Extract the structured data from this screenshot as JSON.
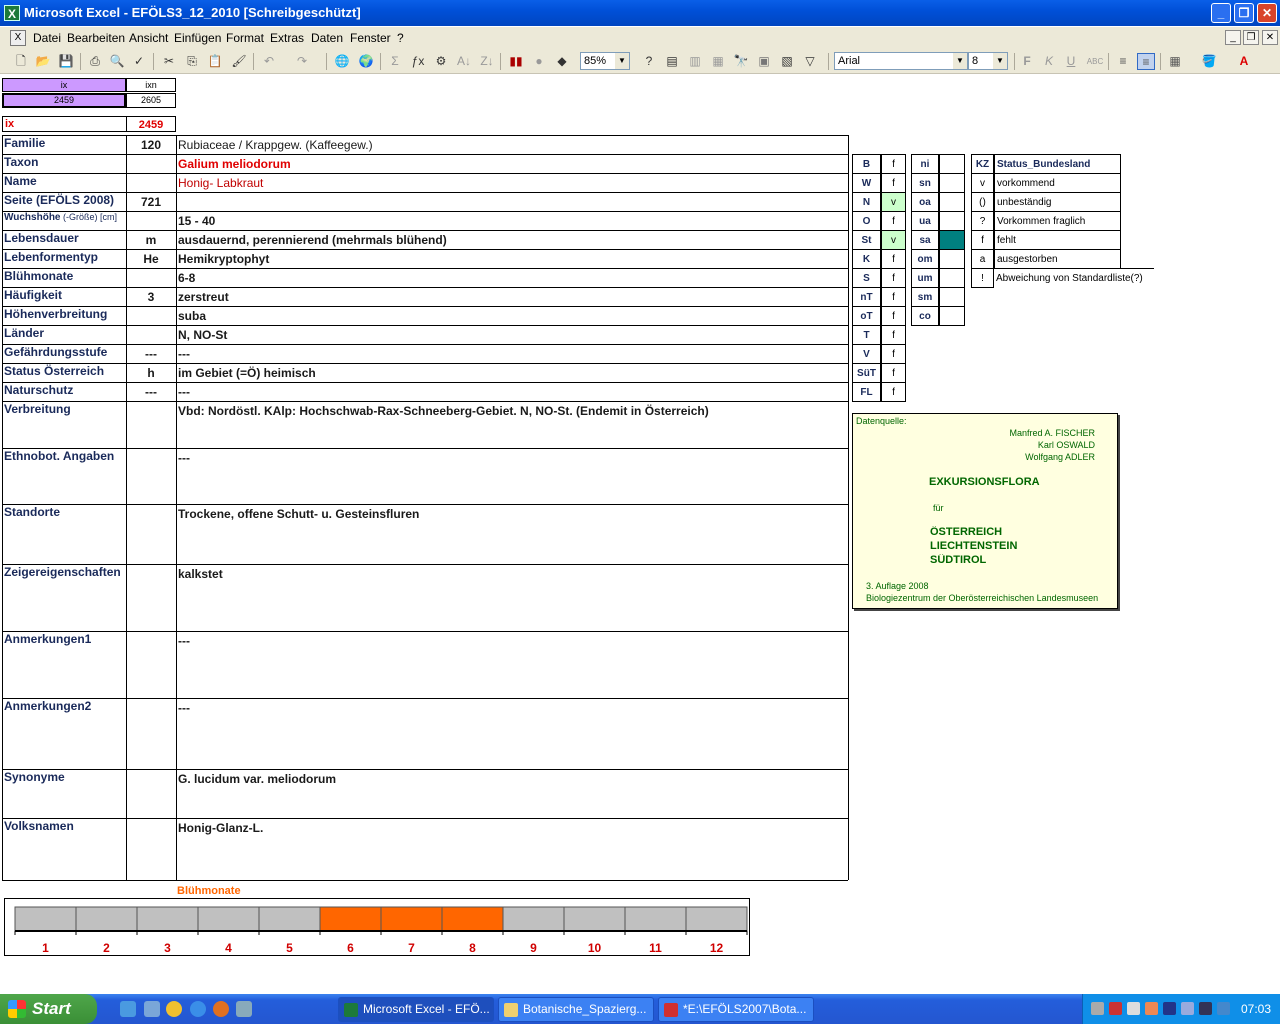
{
  "window": {
    "title": "Microsoft Excel - EFÖLS3_12_2010  [Schreibgeschützt]",
    "app_icon": "excel-icon"
  },
  "menu": {
    "items": [
      "Datei",
      "Bearbeiten",
      "Ansicht",
      "Einfügen",
      "Format",
      "Extras",
      "Daten",
      "Fenster",
      "?"
    ]
  },
  "toolbar": {
    "zoom": "85%",
    "font": "Arial",
    "font_size": "8",
    "style_f": "F",
    "style_k": "K",
    "style_u": "U"
  },
  "index_box": {
    "ix_header": "ix",
    "ixn_header": "ixn",
    "ix_value": "2459",
    "ixn_value": "2605",
    "ix_label": "ix",
    "ix_red_value": "2459"
  },
  "record": [
    {
      "label": "Familie",
      "code": "120",
      "value": "Rubiaceae  /  Krappgew. (Kaffeegew.)"
    },
    {
      "label": "Taxon",
      "code": "",
      "value": "Galium meliodorum"
    },
    {
      "label": "Name",
      "code": "",
      "value": "Honig- Labkraut"
    },
    {
      "label": "Seite (EFÖLS 2008)",
      "code": "721",
      "value": ""
    },
    {
      "label": "Wuchshöhe",
      "label_suffix": " (-Größe) [cm]",
      "code": "",
      "value": "15 - 40"
    },
    {
      "label": "Lebensdauer",
      "code": "m",
      "value": "ausdauernd, perennierend (mehrmals blühend)"
    },
    {
      "label": "Lebenformentyp",
      "code": "He",
      "value": "Hemikryptophyt"
    },
    {
      "label": "Blühmonate",
      "code": "",
      "value": "6-8"
    },
    {
      "label": "Häufigkeit",
      "code": "3",
      "value": "zerstreut"
    },
    {
      "label": "Höhenverbreitung",
      "code": "",
      "value": "suba"
    },
    {
      "label": "Länder",
      "code": "",
      "value": "N, NO-St"
    },
    {
      "label": "Gefährdungsstufe",
      "code": "---",
      "value": "---"
    },
    {
      "label": "Status Österreich",
      "code": "h",
      "value": "im Gebiet (=Ö) heimisch"
    },
    {
      "label": "Naturschutz",
      "code": "---",
      "value": "---"
    },
    {
      "label": "Verbreitung",
      "code": "",
      "value": "Vbd: Nordöstl. KAlp: Hochschwab-Rax-Schneeberg-Gebiet. N, NO-St. (Endemit in Österreich)"
    },
    {
      "label": "Ethnobot. Angaben",
      "code": "",
      "value": "---"
    },
    {
      "label": "Standorte",
      "code": "",
      "value": "Trockene, offene Schutt- u. Gesteinsfluren"
    },
    {
      "label": "Zeigereigenschaften",
      "code": "",
      "value": "kalkstet"
    },
    {
      "label": "Anmerkungen1",
      "code": "",
      "value": "---"
    },
    {
      "label": "Anmerkungen2",
      "code": "",
      "value": "---"
    },
    {
      "label": "Synonyme",
      "code": "",
      "value": "G. lucidum var. meliodorum"
    },
    {
      "label": "Volksnamen",
      "code": "",
      "value": "Honig-Glanz-L."
    }
  ],
  "laender": [
    {
      "code": "B",
      "flag": "f"
    },
    {
      "code": "W",
      "flag": "f"
    },
    {
      "code": "N",
      "flag": "v"
    },
    {
      "code": "O",
      "flag": "f"
    },
    {
      "code": "St",
      "flag": "v"
    },
    {
      "code": "K",
      "flag": "f"
    },
    {
      "code": "S",
      "flag": "f"
    },
    {
      "code": "nT",
      "flag": "f"
    },
    {
      "code": "oT",
      "flag": "f"
    },
    {
      "code": "T",
      "flag": "f"
    },
    {
      "code": "V",
      "flag": "f"
    },
    {
      "code": "SüT",
      "flag": "f"
    },
    {
      "code": "FL",
      "flag": "f"
    }
  ],
  "hoehen": [
    {
      "code": "ni"
    },
    {
      "code": "sn"
    },
    {
      "code": "oa"
    },
    {
      "code": "ua"
    },
    {
      "code": "sa"
    },
    {
      "code": "om"
    },
    {
      "code": "um"
    },
    {
      "code": "sm"
    },
    {
      "code": "co"
    }
  ],
  "legend": {
    "header_code": "KZ",
    "header_text": "Status_Bundesland",
    "rows": [
      {
        "code": "v",
        "text": "vorkommend"
      },
      {
        "code": "()",
        "text": "unbeständig"
      },
      {
        "code": "?",
        "text": "Vorkommen fraglich"
      },
      {
        "code": "f",
        "text": "fehlt"
      },
      {
        "code": "a",
        "text": "ausgestorben"
      },
      {
        "code": "!",
        "text": "Abweichung von Standardliste(?)"
      }
    ]
  },
  "source": {
    "label": "Datenquelle:",
    "authors": [
      "Manfred A. FISCHER",
      "Karl OSWALD",
      "Wolfgang ADLER"
    ],
    "title": "EXKURSIONSFLORA",
    "fuer": "für",
    "countries": [
      "ÖSTERREICH",
      "LIECHTENSTEIN",
      "SÜDTIROL"
    ],
    "edition": "3. Auflage 2008",
    "publisher": "Biologiezentrum der Oberösterreichischen Landesmuseen"
  },
  "bloom_chart": {
    "title": "Blühmonate",
    "months": [
      "1",
      "2",
      "3",
      "4",
      "5",
      "6",
      "7",
      "8",
      "9",
      "10",
      "11",
      "12"
    ],
    "active_months": [
      6,
      7,
      8
    ],
    "active_color": "#ff6600",
    "inactive_color": "#c0c0c0"
  },
  "taskbar": {
    "start": "Start",
    "tasks": [
      "Microsoft Excel - EFÖ...",
      "Botanische_Spazierg...",
      "*E:\\EFÖLS2007\\Bota..."
    ],
    "clock": "07:03"
  },
  "colors": {
    "index_purple": "#cc99ff",
    "teal_marker": "#008080",
    "flag_green": "#ccffcc",
    "label_navy": "#1a2a5a",
    "taxon_red": "#e00000",
    "source_bg": "#ffffe0",
    "source_text": "#006600"
  }
}
